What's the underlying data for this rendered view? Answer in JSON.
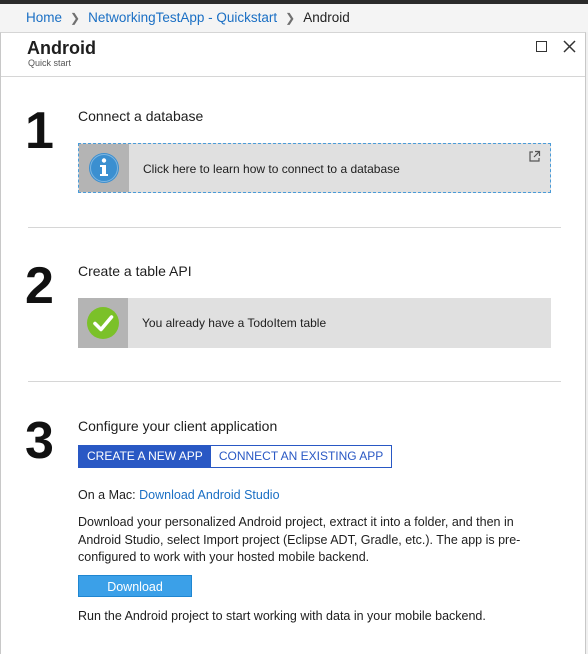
{
  "breadcrumb": {
    "items": [
      "Home",
      "NetworkingTestApp - Quickstart"
    ],
    "current": "Android"
  },
  "blade": {
    "title": "Android",
    "subtitle": "Quick start"
  },
  "steps": [
    {
      "number": "1",
      "title": "Connect a database",
      "box_text": "Click here to learn how to connect to a database",
      "icon": "info-icon"
    },
    {
      "number": "2",
      "title": "Create a table API",
      "box_text": "You already have a TodoItem table",
      "icon": "checkmark-icon"
    },
    {
      "number": "3",
      "title": "Configure your client application",
      "tabs": [
        "CREATE A NEW APP",
        "CONNECT AN EXISTING APP"
      ],
      "active_tab": "CREATE A NEW APP",
      "mac_prefix": "On a Mac:",
      "mac_link": "Download Android Studio",
      "instructions": "Download your personalized Android project, extract it into a folder, and then in Android Studio, select Import project (Eclipse ADT, Gradle, etc.). The app is pre-configured to work with your hosted mobile backend.",
      "download_label": "Download",
      "run_text": "Run the Android project to start working with data in your mobile backend."
    }
  ],
  "colors": {
    "accent": "#2958c4",
    "link": "#1a6fc4",
    "download": "#3ba0e8",
    "success": "#7bc129",
    "info": "#3b8fd0"
  }
}
